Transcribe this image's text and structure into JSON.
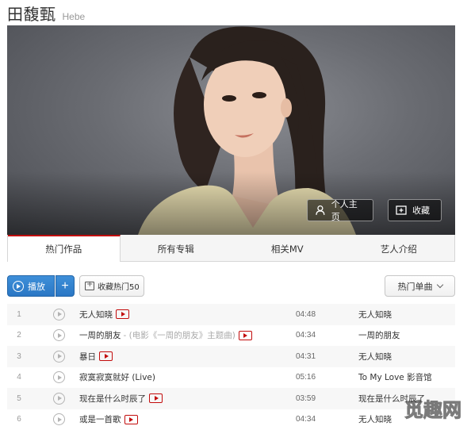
{
  "artist": {
    "name": "田馥甄",
    "alias": "Hebe"
  },
  "banner": {
    "home_label": "个人主页",
    "fav_label": "收藏",
    "home_icon": "user-icon",
    "fav_icon": "folder-add-icon"
  },
  "tabs": [
    {
      "label": "热门作品",
      "active": true
    },
    {
      "label": "所有专辑",
      "active": false
    },
    {
      "label": "相关MV",
      "active": false
    },
    {
      "label": "艺人介绍",
      "active": false
    }
  ],
  "toolbar": {
    "play_label": "播放",
    "add_label": "+",
    "collect_label": "收藏热门50",
    "sort_label": "热门单曲"
  },
  "songs": [
    {
      "index": "1",
      "title": "无人知晓",
      "subtitle": "",
      "mv": true,
      "duration": "04:48",
      "album": "无人知晓"
    },
    {
      "index": "2",
      "title": "一周的朋友",
      "subtitle": "- (电影《一周的朋友》主题曲)",
      "mv": true,
      "duration": "04:34",
      "album": "一周的朋友"
    },
    {
      "index": "3",
      "title": "暴日",
      "subtitle": "",
      "mv": true,
      "duration": "04:31",
      "album": "无人知晓"
    },
    {
      "index": "4",
      "title": "寂寞寂寞就好 (Live)",
      "subtitle": "",
      "mv": false,
      "duration": "05:16",
      "album": "To My Love 影音馆"
    },
    {
      "index": "5",
      "title": "现在是什么时辰了",
      "subtitle": "",
      "mv": true,
      "duration": "03:59",
      "album": "现在是什么时辰了"
    },
    {
      "index": "6",
      "title": "或是一首歌",
      "subtitle": "",
      "mv": true,
      "duration": "04:34",
      "album": "无人知晓"
    }
  ],
  "watermark": "觅趣网",
  "colors": {
    "accent": "#c20c0c",
    "play_button": "#2a77c4",
    "banner_bg": "#6a6c72"
  }
}
